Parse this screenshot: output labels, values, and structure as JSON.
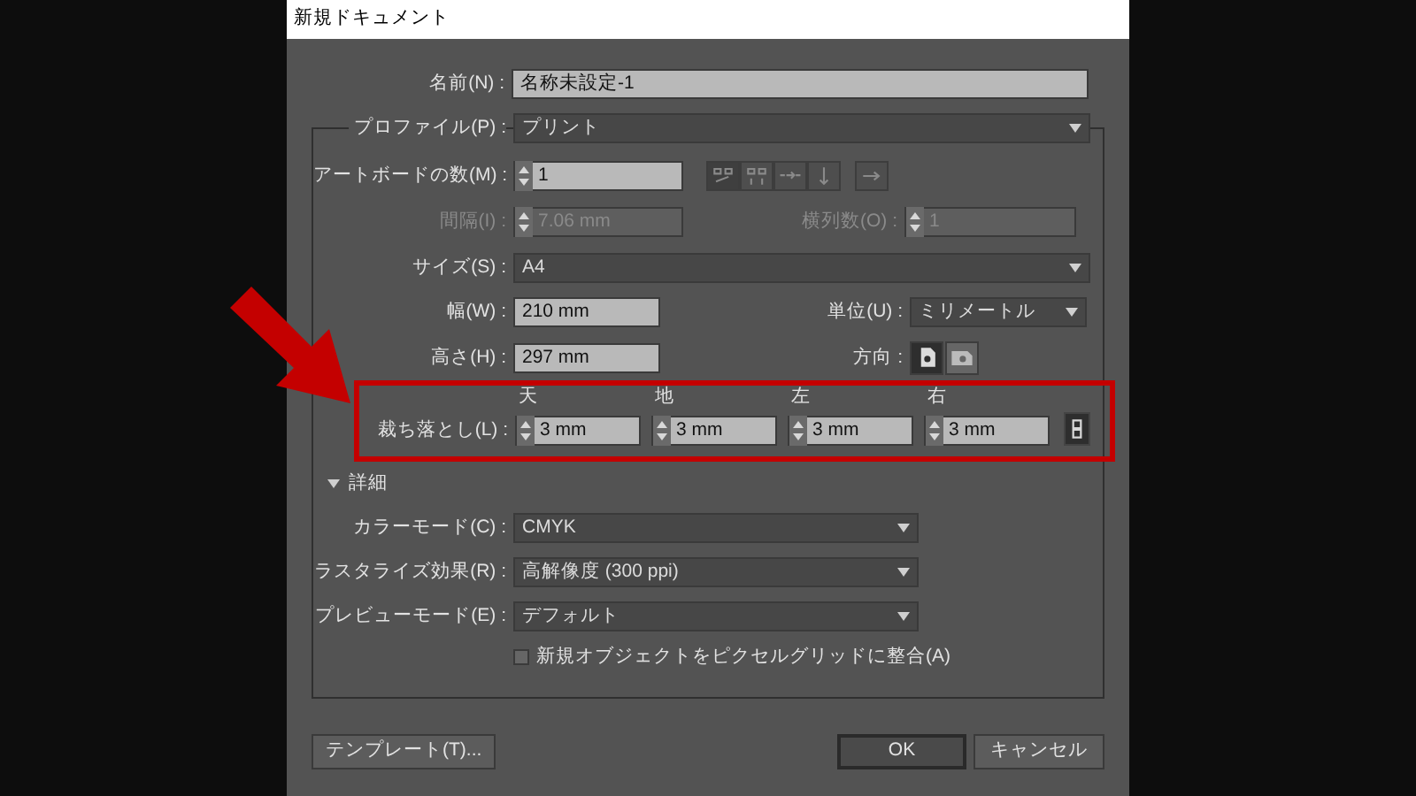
{
  "window": {
    "title": "新規ドキュメント"
  },
  "name": {
    "label": "名前(N) :",
    "value": "名称未設定-1"
  },
  "profile": {
    "label": "プロファイル(P) :",
    "value": "プリント"
  },
  "artboards": {
    "label": "アートボードの数(M) :",
    "value": "1"
  },
  "spacing": {
    "label": "間隔(I) :",
    "value": "7.06 mm",
    "disabled": true
  },
  "columns": {
    "label": "横列数(O) :",
    "value": "1",
    "disabled": true
  },
  "size": {
    "label": "サイズ(S) :",
    "value": "A4"
  },
  "width": {
    "label": "幅(W) :",
    "value": "210 mm"
  },
  "units": {
    "label": "単位(U) :",
    "value": "ミリメートル"
  },
  "height": {
    "label": "高さ(H) :",
    "value": "297 mm"
  },
  "orientation": {
    "label": "方向 :",
    "options": [
      {
        "kind": "portrait",
        "selected": true
      },
      {
        "kind": "landscape",
        "selected": false
      }
    ]
  },
  "bleed": {
    "label": "裁ち落とし(L) :",
    "fields": [
      {
        "heading": "天",
        "value": "3 mm"
      },
      {
        "heading": "地",
        "value": "3 mm"
      },
      {
        "heading": "左",
        "value": "3 mm"
      },
      {
        "heading": "右",
        "value": "3 mm"
      }
    ]
  },
  "advanced": {
    "label": "詳細",
    "expanded": true
  },
  "color_mode": {
    "label": "カラーモード(C) :",
    "value": "CMYK"
  },
  "raster_effects": {
    "label": "ラスタライズ効果(R) :",
    "value": "高解像度 (300 ppi)"
  },
  "preview_mode": {
    "label": "プレビューモード(E) :",
    "value": "デフォルト"
  },
  "align_pixel_grid": {
    "label": "新規オブジェクトをピクセルグリッドに整合(A)",
    "checked": false
  },
  "buttons": [
    {
      "label": "テンプレート(T)...",
      "kind": "secondary"
    },
    {
      "label": "OK",
      "kind": "default"
    },
    {
      "label": "キャンセル",
      "kind": "secondary"
    }
  ]
}
